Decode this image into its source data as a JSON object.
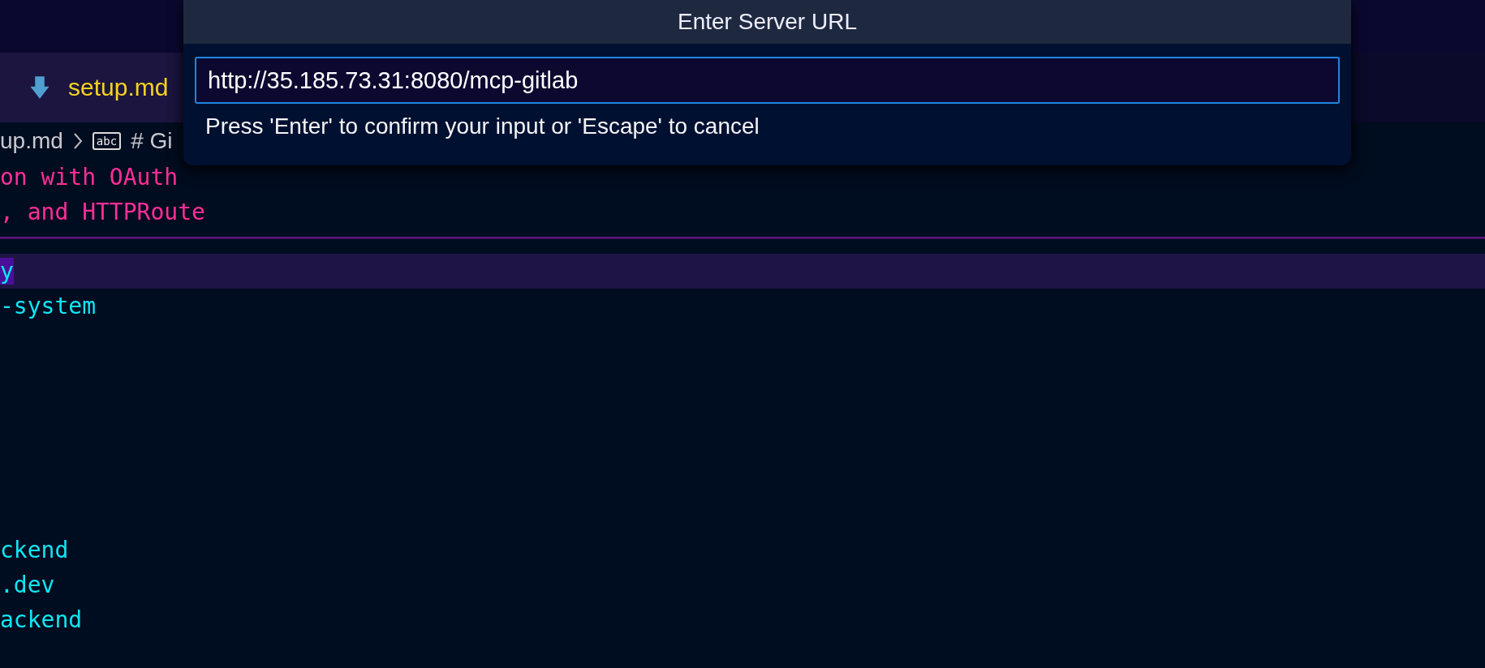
{
  "tabs": [
    {
      "label": "setup.md",
      "selected": true
    }
  ],
  "breadcrumb": {
    "file": "up.md",
    "symbol_badge": "abc",
    "symbol": "# Gi"
  },
  "editor": {
    "lines": [
      {
        "kind": "heading",
        "text": "on with OAuth",
        "current": false,
        "selected": false
      },
      {
        "kind": "heading",
        "text": ", and HTTPRoute",
        "current": false,
        "selected": false
      },
      {
        "kind": "rule"
      },
      {
        "kind": "value",
        "text": "y",
        "current": true,
        "selected": true
      },
      {
        "kind": "value",
        "text": "-system",
        "current": false,
        "selected": false
      },
      {
        "kind": "blank"
      },
      {
        "kind": "blank"
      },
      {
        "kind": "blank"
      },
      {
        "kind": "blank"
      },
      {
        "kind": "blank"
      },
      {
        "kind": "blank"
      },
      {
        "kind": "value",
        "text": "ckend",
        "current": false,
        "selected": false
      },
      {
        "kind": "value",
        "text": ".dev",
        "current": false,
        "selected": false
      },
      {
        "kind": "value",
        "text": "ackend",
        "current": false,
        "selected": false
      }
    ]
  },
  "dialog": {
    "title": "Enter Server URL",
    "value": "http://35.185.73.31:8080/mcp-gitlab",
    "hint": "Press 'Enter' to confirm your input or 'Escape' to cancel"
  }
}
